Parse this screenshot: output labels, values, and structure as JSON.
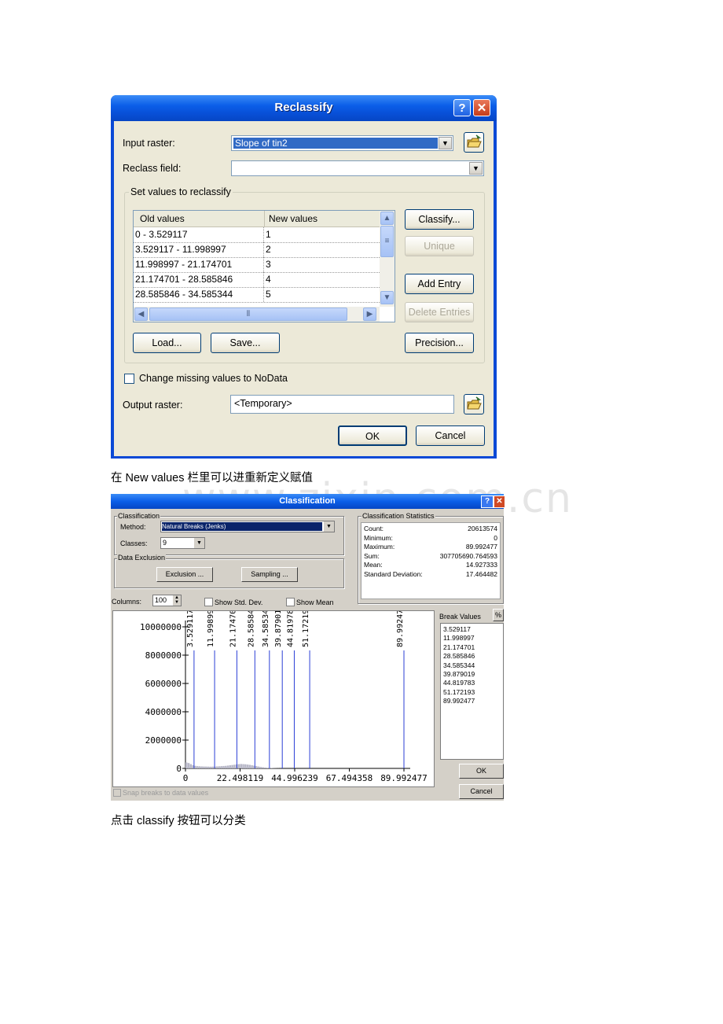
{
  "reclassify": {
    "title": "Reclassify",
    "help_btn": "?",
    "close_btn": "✕",
    "input_raster_label": "Input raster:",
    "input_raster_value": "Slope of tin2",
    "reclass_field_label": "Reclass field:",
    "reclass_field_value": "",
    "group_label": "Set values to reclassify",
    "col_old": "Old values",
    "col_new": "New values",
    "rows": [
      {
        "old": "0 - 3.529117",
        "new": "1"
      },
      {
        "old": "3.529117 - 11.998997",
        "new": "2"
      },
      {
        "old": "11.998997 - 21.174701",
        "new": "3"
      },
      {
        "old": "21.174701 - 28.585846",
        "new": "4"
      },
      {
        "old": "28.585846 - 34.585344",
        "new": "5"
      }
    ],
    "btn_classify": "Classify...",
    "btn_unique": "Unique",
    "btn_add_entry": "Add Entry",
    "btn_delete_entries": "Delete Entries",
    "btn_load": "Load...",
    "btn_save": "Save...",
    "btn_precision": "Precision...",
    "missing_label": "Change missing values to NoData",
    "output_raster_label": "Output raster:",
    "output_raster_value": "<Temporary>",
    "btn_ok": "OK",
    "btn_cancel": "Cancel"
  },
  "caption1": "在 New values 栏里可以进重新定义赋值",
  "caption2": "点击 classify 按钮可以分类",
  "watermark": "www.zixin.com.cn",
  "classification": {
    "title": "Classification",
    "help_btn": "?",
    "close_btn": "✕",
    "classification_group": "Classification",
    "method_label": "Method:",
    "method_value": "Natural Breaks (Jenks)",
    "classes_label": "Classes:",
    "classes_value": "9",
    "exclusion_group": "Data Exclusion",
    "btn_exclusion": "Exclusion ...",
    "btn_sampling": "Sampling ...",
    "stats_group": "Classification Statistics",
    "stats": [
      {
        "label": "Count:",
        "value": "20613574"
      },
      {
        "label": "Minimum:",
        "value": "0"
      },
      {
        "label": "Maximum:",
        "value": "89.992477"
      },
      {
        "label": "Sum:",
        "value": "307705690.764593"
      },
      {
        "label": "Mean:",
        "value": "14.927333"
      },
      {
        "label": "Standard Deviation:",
        "value": "17.464482"
      }
    ],
    "columns_label": "Columns:",
    "columns_value": "100",
    "show_std_label": "Show Std. Dev.",
    "show_mean_label": "Show Mean",
    "break_values_label": "Break Values",
    "pct_btn": "%",
    "break_values": [
      "3.529117",
      "11.998997",
      "21.174701",
      "28.585846",
      "34.585344",
      "39.879019",
      "44.819783",
      "51.172193",
      "89.992477"
    ],
    "btn_ok": "OK",
    "btn_cancel": "Cancel",
    "snap_label": "Snap breaks to data values"
  },
  "chart_data": {
    "type": "bar",
    "xlim": [
      0,
      89.992477
    ],
    "ylim": [
      0,
      10000000
    ],
    "x_ticks": [
      "0",
      "22.498119",
      "44.996239",
      "67.494358",
      "89.992477"
    ],
    "y_ticks": [
      "0",
      "2000000",
      "4000000",
      "6000000",
      "8000000",
      "10000000"
    ],
    "breaks": [
      3.529117,
      11.998997,
      21.174701,
      28.585846,
      34.585344,
      39.879019,
      44.819783,
      51.172193,
      89.992477
    ],
    "break_labels": [
      "3.529117",
      "11.998997",
      "21.174701",
      "28.585846",
      "34.585344",
      "39.879019",
      "44.819783",
      "51.172193",
      "89.992477"
    ],
    "histogram": [
      420000,
      380000,
      300000,
      220000,
      180000,
      160000,
      150000,
      140000,
      135000,
      130000,
      125000,
      120000,
      125000,
      130000,
      140000,
      150000,
      160000,
      170000,
      180000,
      200000,
      220000,
      240000,
      260000,
      280000,
      300000,
      310000,
      300000,
      290000,
      270000,
      250000,
      220000,
      190000,
      160000,
      130000,
      100000,
      80000,
      60000,
      45000,
      35000,
      25000,
      18000,
      12000,
      8000,
      5000,
      3000,
      2000,
      1500,
      1000,
      800,
      600,
      400,
      300,
      200,
      150,
      100,
      80,
      60,
      40,
      30,
      20,
      10,
      10,
      5,
      5,
      5,
      5,
      5,
      5,
      5,
      5,
      5,
      5,
      5,
      5,
      5,
      5,
      5,
      5,
      5,
      5
    ]
  }
}
